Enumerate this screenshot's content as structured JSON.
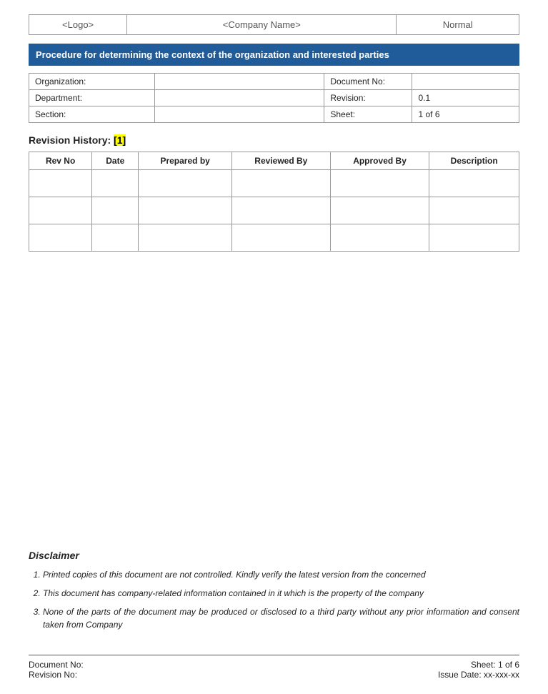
{
  "header": {
    "logo_label": "<Logo>",
    "company_name": "<Company Name>",
    "status": "Normal"
  },
  "title": "Procedure for determining the context of the organization and interested parties",
  "info_fields": {
    "organization_label": "Organization:",
    "organization_value": "",
    "document_no_label": "Document No:",
    "document_no_value": "",
    "department_label": "Department:",
    "department_value": "",
    "revision_label": "Revision:",
    "revision_value": "0.1",
    "section_label": "Section:",
    "section_value": "",
    "sheet_label": "Sheet:",
    "sheet_value": "1 of 6"
  },
  "revision_history": {
    "heading": "Revision History:",
    "bracket_num": "[1]",
    "columns": [
      "Rev No",
      "Date",
      "Prepared by",
      "Reviewed By",
      "Approved By",
      "Description"
    ],
    "rows": [
      [
        "",
        "",
        "",
        "",
        "",
        ""
      ],
      [
        "",
        "",
        "",
        "",
        "",
        ""
      ],
      [
        "",
        "",
        "",
        "",
        "",
        ""
      ]
    ]
  },
  "disclaimer": {
    "title": "Disclaimer",
    "items": [
      "Printed copies of this document are not controlled. Kindly verify the latest version from the concerned",
      "This document has company-related information contained in it which is the property of the company",
      "None of the parts of the document may be produced or disclosed to a third party without any prior information and consent taken from Company"
    ]
  },
  "footer": {
    "document_no_label": "Document No:",
    "document_no_value": "",
    "revision_no_label": "Revision No:",
    "revision_no_value": "",
    "sheet_label": "Sheet: 1 of 6",
    "issue_date_label": "Issue Date:",
    "issue_date_value": "xx-xxx-xx"
  }
}
